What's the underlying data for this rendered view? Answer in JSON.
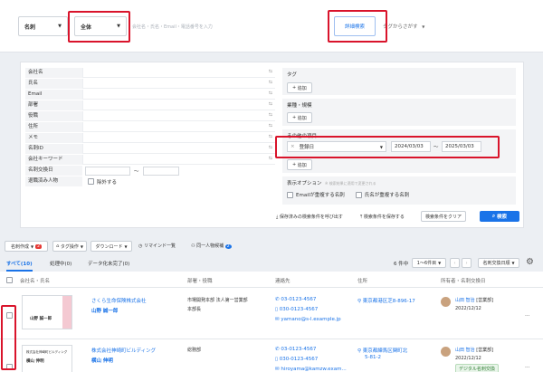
{
  "topbar": {
    "scope_select": "名刺",
    "target_select": "全体",
    "search_placeholder": "会社名・氏名・Email・電話番号を入力",
    "advanced_search": "詳細検索",
    "tag_search": "タグからさがす"
  },
  "filters": {
    "fields": [
      "会社名",
      "氏名",
      "Email",
      "部署",
      "役職",
      "住所",
      "メモ",
      "名刺ID",
      "会社キーワード",
      "名刺交換日",
      "退職済み人物"
    ],
    "exclude_label": "除外する",
    "date_tilde": "〜",
    "tag_title": "タグ",
    "add_label": "追加",
    "industry_title": "業種・規模",
    "other_title": "その他の項目",
    "other_field": "登録日",
    "date_from": "2024/03/03",
    "date_to": "2025/03/03",
    "display_option_title": "表示オプション",
    "display_option_note": "※ 検索結果に適用で変更される",
    "opt_email_dup": "Emailが重複する名刺",
    "opt_name_dup": "氏名が重複する名刺",
    "saved_call": "保存済みの検索条件を呼び出す",
    "save_cond": "検索条件を保存する",
    "clear": "検索条件をクリア",
    "search": "検索"
  },
  "toolbar": {
    "create_card": "名刺作成",
    "create_badge": "2",
    "tag_ops": "タグ操作",
    "download": "ダウンロード",
    "remind": "リマインド一覧",
    "same_person": "同一人物候補",
    "same_badge": "2"
  },
  "tabs": {
    "all": "すべて(10)",
    "in_progress": "処理中(0)",
    "incomplete": "データ化未完了(0)",
    "count": "6 件中",
    "range": "1〜6件目",
    "sort": "名刺交換日順"
  },
  "headers": {
    "company_name": "会社名・氏名",
    "dept_title": "部署・役職",
    "contact": "連絡先",
    "address": "住所",
    "owner": "所有者・名刺交換日"
  },
  "rows": [
    {
      "company": "さくら生命保険株式会社",
      "name": "山野 誠一郎",
      "dept": "市場開発本部 法人第一営業部",
      "dept2": "本部長",
      "phone1": "03-0123-4567",
      "phone2": "030-0123-4567",
      "email": "yamano@s-l.example.jp",
      "addr1": "東京都港区芝8-896-17",
      "addr2": "",
      "owner": "山田 智治",
      "owner_tag": "[営業部]",
      "date": "2022/12/12",
      "card_company": "",
      "card_name": "山野 誠一郎",
      "badge": ""
    },
    {
      "company": "株式会社神崎町ビルディング",
      "name": "横山 伸明",
      "dept": "総務部",
      "dept2": "",
      "phone1": "03-0123-4567",
      "phone2": "030-0123-4567",
      "email": "hiroyama@kamzw.exam...",
      "addr1": "東京都練馬区関町北",
      "addr2": "5-81-2",
      "owner": "山田 智治",
      "owner_tag": "[営業部]",
      "date": "2022/12/12",
      "card_company": "株式会社神崎町ビルディング",
      "card_name": "横山 伸明",
      "badge": "デジタル名刺交換"
    }
  ],
  "colors": {
    "accent": "#1a73e8",
    "highlight": "#d9142b",
    "badge": "#e53935"
  }
}
